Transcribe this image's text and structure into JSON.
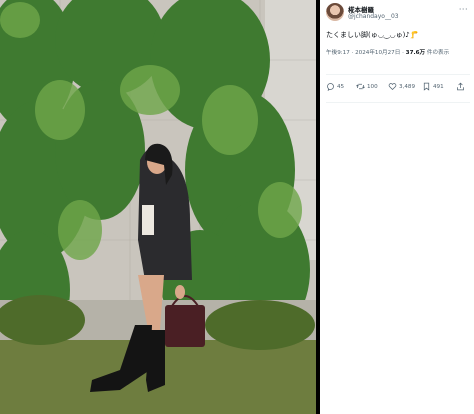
{
  "post": {
    "author_name": "椛本樹羅",
    "author_handle": "@jchandayo__03",
    "text": "たくましい脚(ゅ◡‿◡ゅ)♪🦵",
    "time": "午後9:17 · 2024年10月27日 · ",
    "views_count": "37.6万",
    "views_label": " 件の表示"
  },
  "actions": {
    "reply_count": "45",
    "repost_count": "100",
    "like_count": "3,489",
    "bookmark_count": "491"
  },
  "icons": [
    "more-icon",
    "reply-icon",
    "repost-icon",
    "like-icon",
    "bookmark-icon",
    "share-icon"
  ],
  "colors": {
    "text": "#0f1419",
    "secondary": "#536471",
    "foliage": "#4f8a3a"
  }
}
